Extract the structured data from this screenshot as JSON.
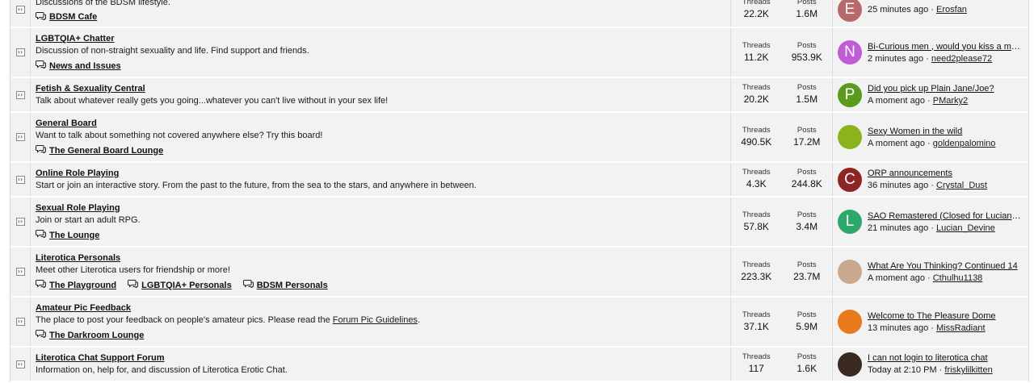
{
  "labels": {
    "threads": "Threads",
    "posts": "Posts",
    "separator": "·"
  },
  "forums": [
    {
      "title": "",
      "desc": "Discussions of the BDSM lifestyle.",
      "subforums": [
        "BDSM Cafe"
      ],
      "threads": "22.2K",
      "posts": "1.6M",
      "last": {
        "title": "",
        "time": "25 minutes ago",
        "user": "Erosfan",
        "avatar_letter": "E",
        "avatar_color": "#b86a6a"
      }
    },
    {
      "title": "LGBTQIA+ Chatter",
      "desc": "Discussion of non-straight sexuality and life. Find support and friends.",
      "subforums": [
        "News and Issues"
      ],
      "threads": "11.2K",
      "posts": "953.9K",
      "last": {
        "title": "Bi-Curious men , would you kiss a man?",
        "time": "2 minutes ago",
        "user": "need2please72",
        "avatar_letter": "N",
        "avatar_color": "#c15bd6"
      }
    },
    {
      "title": "Fetish & Sexuality Central",
      "desc": "Talk about whatever really gets you going...whatever you can't live without in your sex life!",
      "subforums": [],
      "threads": "20.2K",
      "posts": "1.5M",
      "last": {
        "title": "Did you pick up Plain Jane/Joe?",
        "time": "A moment ago",
        "user": "PMarky2",
        "avatar_letter": "P",
        "avatar_color": "#5a9a1f"
      }
    },
    {
      "title": "General Board",
      "desc": "Want to talk about something not covered anywhere else? Try this board!",
      "subforums": [
        "The General Board Lounge"
      ],
      "threads": "490.5K",
      "posts": "17.2M",
      "last": {
        "title": "Sexy Women in the wild",
        "time": "A moment ago",
        "user": "goldenpalomino",
        "avatar_letter": "",
        "avatar_color": "#8ab31e"
      }
    },
    {
      "title": "Online Role Playing",
      "desc": "Start or join an interactive story. From the past to the future, from the sea to the stars, and anywhere in between.",
      "subforums": [],
      "threads": "4.3K",
      "posts": "244.8K",
      "last": {
        "title": "ORP announcements",
        "time": "36 minutes ago",
        "user": "Crystal_Dust",
        "avatar_letter": "C",
        "avatar_color": "#8e2525"
      }
    },
    {
      "title": "Sexual Role Playing",
      "desc": "Join or start an adult RPG.",
      "subforums": [
        "The Lounge"
      ],
      "threads": "57.8K",
      "posts": "3.4M",
      "last": {
        "title": "SAO Remastered (Closed for Lucian_…",
        "time": "21 minutes ago",
        "user": "Lucian_Devine",
        "avatar_letter": "L",
        "avatar_color": "#2ea86a"
      }
    },
    {
      "title": "Literotica Personals",
      "desc": "Meet other Literotica users for friendship or more!",
      "subforums": [
        "The Playground",
        "LGBTQIA+ Personals",
        "BDSM Personals"
      ],
      "threads": "223.3K",
      "posts": "23.7M",
      "last": {
        "title": "What Are You Thinking? Continued 14",
        "time": "A moment ago",
        "user": "Cthulhu1138",
        "avatar_letter": "",
        "avatar_color": "#c8a98e"
      }
    },
    {
      "title": "Amateur Pic Feedback",
      "desc": "The place to post your feedback on people's amateur pics. Please read the",
      "desc_link": "Forum Pic Guidelines",
      "desc_end": ".",
      "subforums": [
        "The Darkroom Lounge"
      ],
      "threads": "37.1K",
      "posts": "5.9M",
      "last": {
        "title": "Welcome to The Pleasure Dome",
        "time": "13 minutes ago",
        "user": "MissRadiant",
        "avatar_letter": "",
        "avatar_color": "#e87a1c"
      }
    },
    {
      "title": "Literotica Chat Support Forum",
      "desc": "Information on, help for, and discussion of Literotica Erotic Chat.",
      "subforums": [],
      "threads": "117",
      "posts": "1.6K",
      "last": {
        "title": "I can not login to literotica chat",
        "time": "Today at 2:10 PM",
        "user": "friskylilkitten",
        "avatar_letter": "",
        "avatar_color": "#3a2a22"
      }
    }
  ]
}
